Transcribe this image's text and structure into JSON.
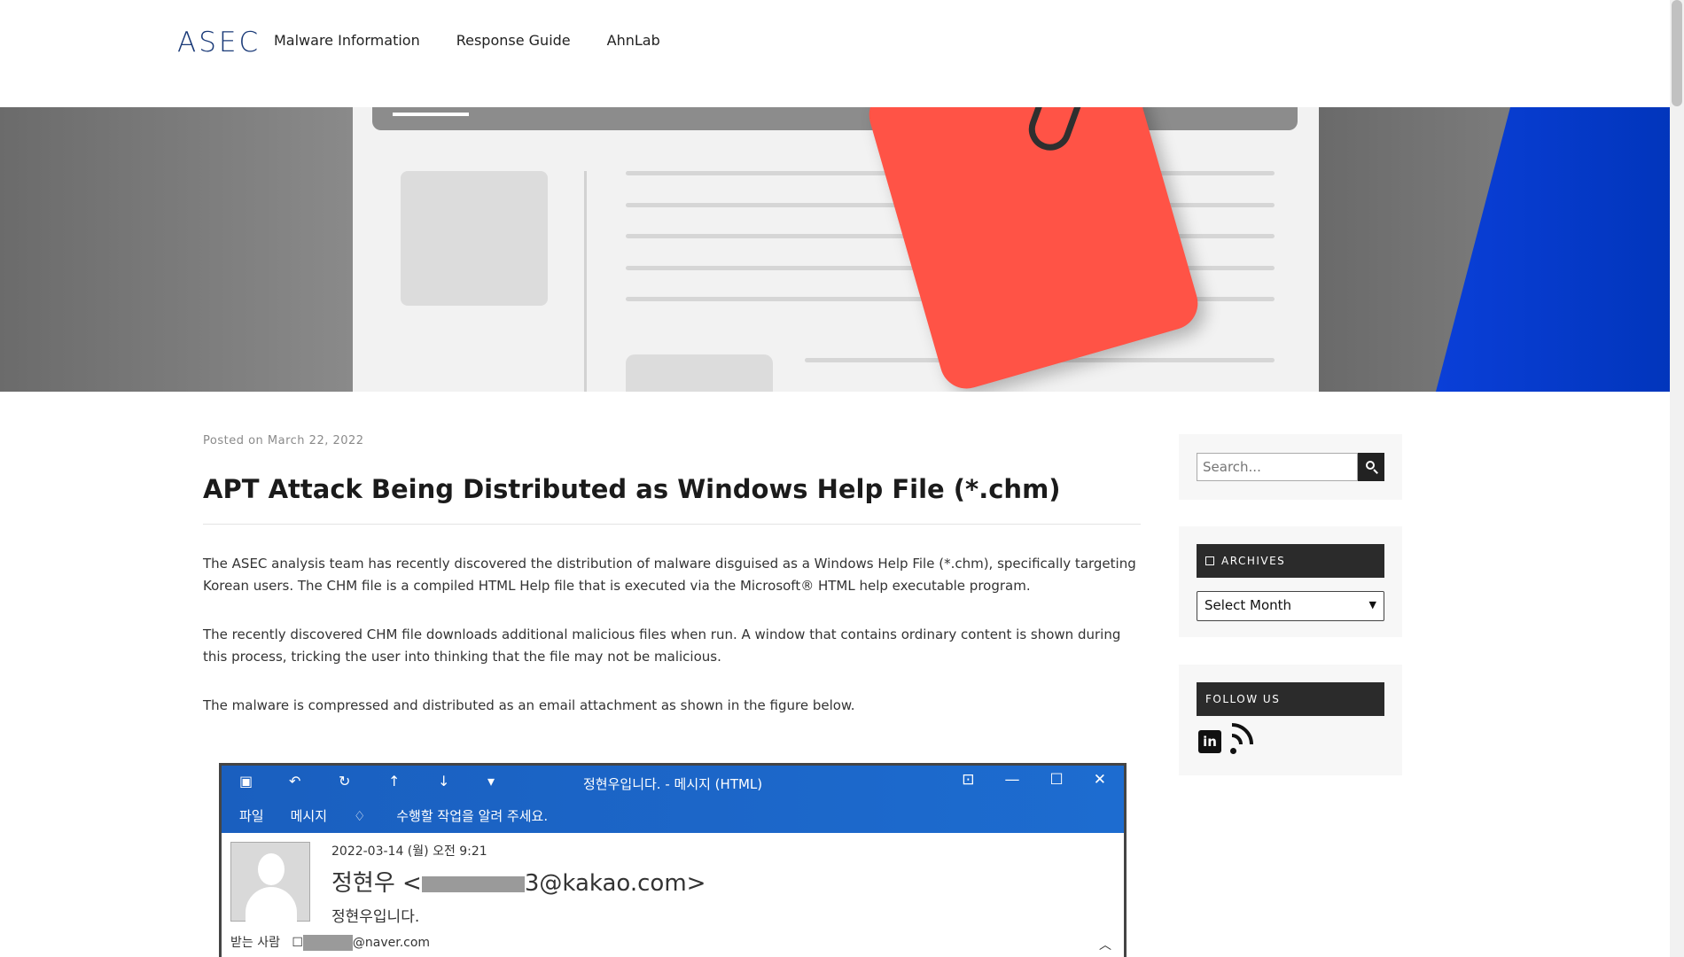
{
  "header": {
    "logo_text": "ASEC",
    "nav": [
      {
        "label": "Malware Information"
      },
      {
        "label": "Response Guide"
      },
      {
        "label": "AhnLab"
      }
    ]
  },
  "article": {
    "posted_prefix": "Posted on",
    "posted_date": "March 22, 2022",
    "title": "APT Attack Being Distributed as Windows Help File (*.chm)",
    "paragraphs": [
      "The ASEC analysis team has recently discovered the distribution of malware disguised as a Windows Help File (*.chm), specifically targeting Korean users. The CHM file is a compiled HTML Help file that is executed via the Microsoft® HTML help executable program.",
      "The recently discovered CHM file downloads additional malicious files when run. A window that contains ordinary content is shown during this process, tricking the user into thinking that the file may not be malicious.",
      "The malware is compressed and distributed as an email attachment as shown in the figure below."
    ]
  },
  "figure": {
    "window_title": "정현우입니다. - 메시지 (HTML)",
    "menu": [
      "파일",
      "메시지",
      "수행할 작업을 알려 주세요."
    ],
    "datetime": "2022-03-14 (월) 오전 9:21",
    "from_name": "정현우 <",
    "from_domain": "3@kakao.com>",
    "subject": "정현우입니다.",
    "to_label": "받는 사람",
    "to_domain": "@naver.com"
  },
  "sidebar": {
    "search": {
      "placeholder": "Search..."
    },
    "archives": {
      "heading": "ARCHIVES",
      "select_value": "Select Month"
    },
    "follow": {
      "heading": "FOLLOW US"
    }
  },
  "colors": {
    "brand": "#1a3a78",
    "hero_tag": "#ff5346",
    "hero_blue": "#0a3fd8",
    "ribbon_blue": "#1a5fbf"
  },
  "icons": [
    "search-icon",
    "calendar-icon",
    "linkedin-icon",
    "rss-icon"
  ]
}
